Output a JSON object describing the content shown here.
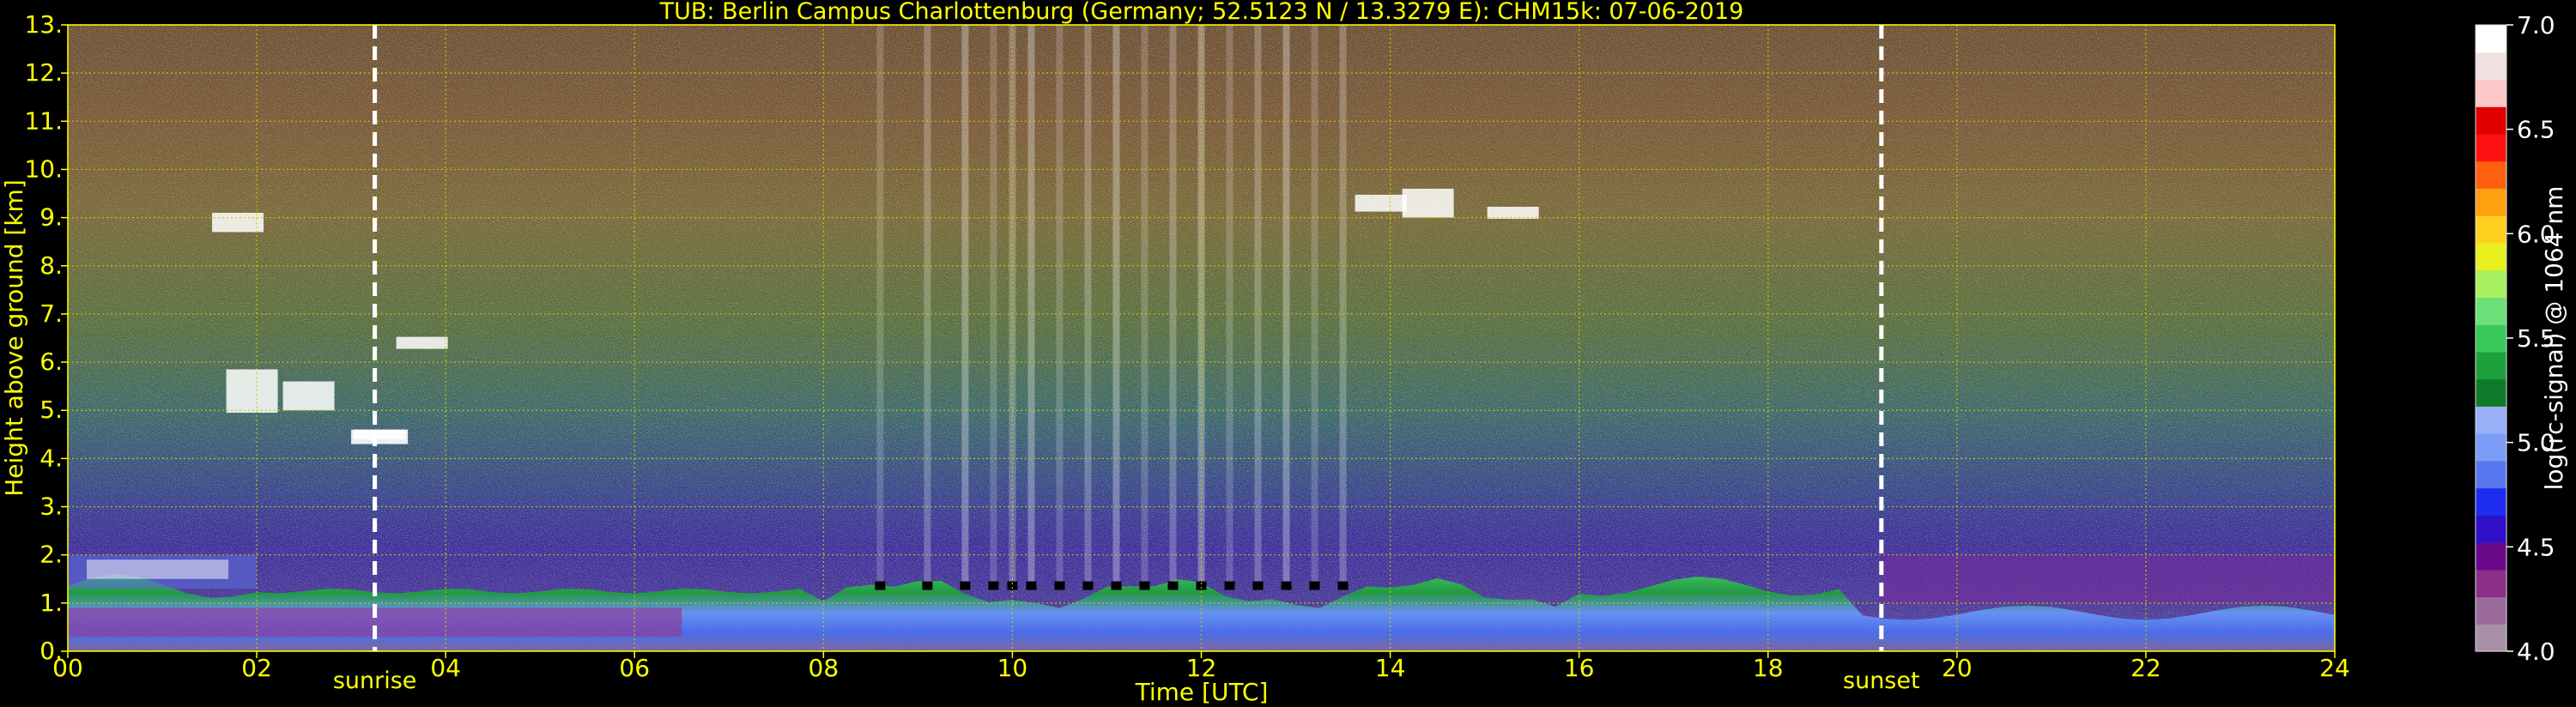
{
  "chart_data": {
    "type": "heatmap",
    "title": "TUB: Berlin Campus Charlottenburg (Germany; 52.5123 N / 13.3279 E):    CHM15k: 07-06-2019",
    "xlabel": "Time [UTC]",
    "ylabel": "Height above ground [km]",
    "colorbar_label": "log(rc-signal) @ 1064 nm",
    "xlim": [
      0,
      24
    ],
    "ylim": [
      0,
      13
    ],
    "color_range": [
      4.0,
      7.0
    ],
    "x_ticks": [
      "00",
      "02",
      "04",
      "06",
      "08",
      "10",
      "12",
      "14",
      "16",
      "18",
      "20",
      "22",
      "24"
    ],
    "y_ticks": [
      "0.",
      "1.",
      "2.",
      "3.",
      "4.",
      "5.",
      "6.",
      "7.",
      "8.",
      "9.",
      "10.",
      "11.",
      "12.",
      "13."
    ],
    "colorbar_ticks": [
      "4.0",
      "4.5",
      "5.0",
      "5.5",
      "6.0",
      "6.5",
      "7.0"
    ],
    "grid": true,
    "annotations": [
      {
        "label": "sunrise",
        "time_utc": 3.25
      },
      {
        "label": "sunset",
        "time_utc": 19.2
      }
    ],
    "colors": {
      "axis_text": "#ffff00",
      "grid": "#cccc00",
      "background": "#000000",
      "marker_lines": "#ffffff",
      "colormap": [
        "#a890a8",
        "#9a6b9a",
        "#8b2f8b",
        "#6a0a8a",
        "#3010c8",
        "#1e2cf0",
        "#5878f0",
        "#7c9cf8",
        "#98b0f8",
        "#0f7a2a",
        "#1ea03c",
        "#38c85a",
        "#6ee07a",
        "#a8f060",
        "#e8f020",
        "#ffd020",
        "#ffa010",
        "#ff6010",
        "#ff1010",
        "#e00000",
        "#ffc8c8",
        "#f0e0e0",
        "#ffffff"
      ]
    }
  }
}
